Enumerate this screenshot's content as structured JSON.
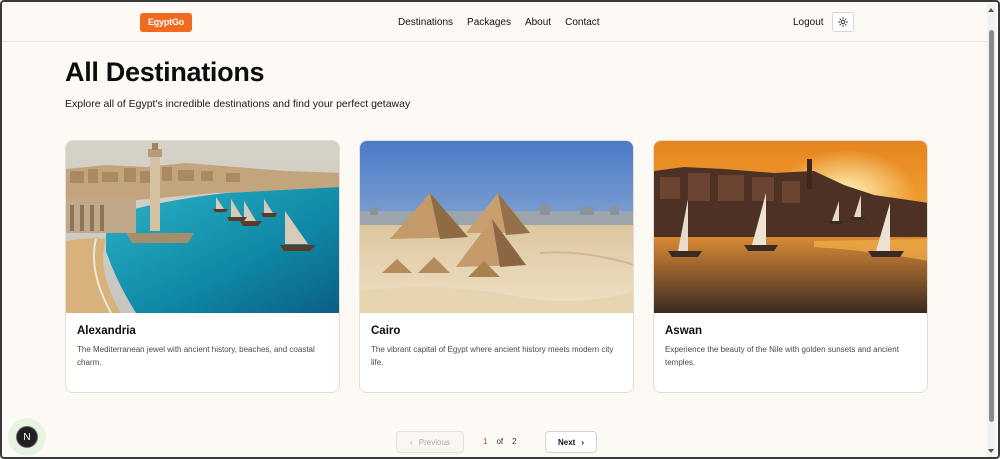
{
  "header": {
    "logo": "EgyptGo",
    "nav": [
      "Destinations",
      "Packages",
      "About",
      "Contact"
    ],
    "logout": "Logout",
    "theme_icon": "sun-icon"
  },
  "main": {
    "title": "All Destinations",
    "subtitle": "Explore all of Egypt's incredible destinations and find your perfect getaway"
  },
  "destinations": [
    {
      "name": "Alexandria",
      "description": "The Mediterranean jewel with ancient history, beaches, and coastal charm."
    },
    {
      "name": "Cairo",
      "description": "The vibrant capital of Egypt where ancient history meets modern city life."
    },
    {
      "name": "Aswan",
      "description": "Experience the beauty of the Nile with golden sunsets and ancient temples."
    }
  ],
  "pagination": {
    "previous": "Previous",
    "current": "1",
    "of": "of",
    "total": "2",
    "next": "Next"
  },
  "dev_badge": "N"
}
